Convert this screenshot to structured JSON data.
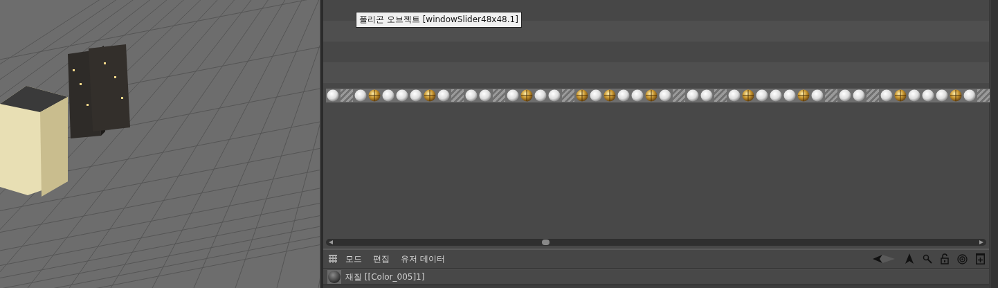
{
  "tooltip": "폴리곤 오브젝트 [windowSlider48x48.1]",
  "materials": [
    {
      "kind": "plain"
    },
    {
      "kind": "empty"
    },
    {
      "kind": "plain"
    },
    {
      "kind": "textured"
    },
    {
      "kind": "plain"
    },
    {
      "kind": "plain"
    },
    {
      "kind": "plain"
    },
    {
      "kind": "textured"
    },
    {
      "kind": "plain"
    },
    {
      "kind": "empty"
    },
    {
      "kind": "plain"
    },
    {
      "kind": "plain"
    },
    {
      "kind": "empty"
    },
    {
      "kind": "plain"
    },
    {
      "kind": "textured"
    },
    {
      "kind": "plain"
    },
    {
      "kind": "plain"
    },
    {
      "kind": "empty"
    },
    {
      "kind": "textured"
    },
    {
      "kind": "plain"
    },
    {
      "kind": "textured"
    },
    {
      "kind": "plain"
    },
    {
      "kind": "plain"
    },
    {
      "kind": "textured"
    },
    {
      "kind": "plain"
    },
    {
      "kind": "empty"
    },
    {
      "kind": "plain"
    },
    {
      "kind": "plain"
    },
    {
      "kind": "empty"
    },
    {
      "kind": "plain"
    },
    {
      "kind": "textured"
    },
    {
      "kind": "plain"
    },
    {
      "kind": "plain"
    },
    {
      "kind": "plain"
    },
    {
      "kind": "textured"
    },
    {
      "kind": "plain"
    },
    {
      "kind": "empty"
    },
    {
      "kind": "plain"
    },
    {
      "kind": "plain"
    },
    {
      "kind": "empty"
    },
    {
      "kind": "plain"
    },
    {
      "kind": "textured"
    },
    {
      "kind": "plain"
    },
    {
      "kind": "plain"
    },
    {
      "kind": "plain"
    },
    {
      "kind": "textured"
    },
    {
      "kind": "plain"
    },
    {
      "kind": "empty"
    }
  ],
  "menu": [
    "모드",
    "편집",
    "유저 데이터"
  ],
  "attribute_title": "재질 [[Color_005]1]"
}
